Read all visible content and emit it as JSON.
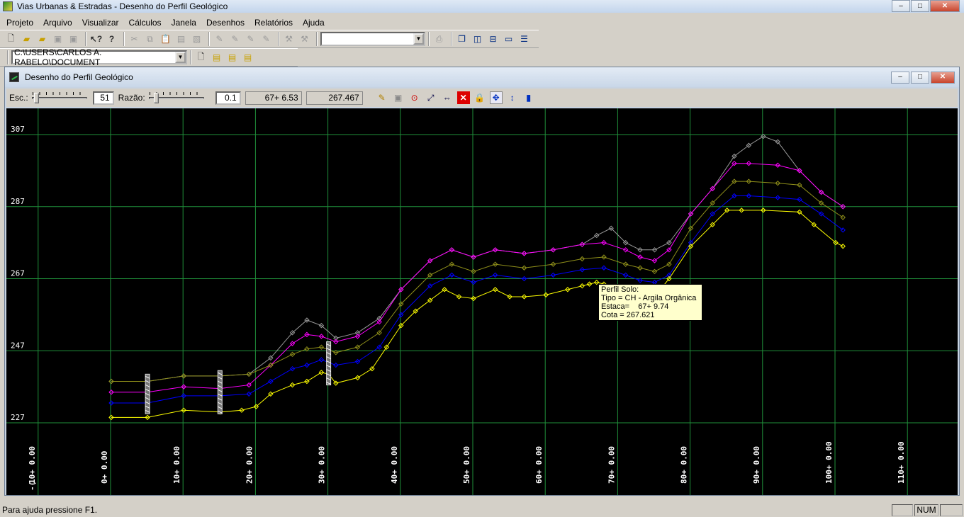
{
  "app": {
    "title": "Vias Urbanas & Estradas -  Desenho do Perfil Geológico",
    "win_min": "‒",
    "win_max": "□",
    "win_close": "✕"
  },
  "menu": [
    "Projeto",
    "Arquivo",
    "Visualizar",
    "Cálculos",
    "Janela",
    "Desenhos",
    "Relatórios",
    "Ajuda"
  ],
  "toolbar2": {
    "path": "C:\\USERS\\CARLOS A. RABELO\\DOCUMENT"
  },
  "child": {
    "title": "Desenho do Perfil Geológico",
    "min": "‒",
    "max": "□",
    "close": "✕"
  },
  "drawtb": {
    "esc_label": "Esc.:",
    "esc_value": "51",
    "razao_label": "Razão:",
    "razao_value": "0.1",
    "estaca_readout": "67+ 6.53",
    "cota_readout": "267.467",
    "esc_slider_level": 0.05,
    "razao_slider_level": 0.1
  },
  "tooltip": {
    "line1": "Perfil Solo:",
    "line2": "Tipo = CH - Argila Orgânica",
    "line3": "Estaca=    67+ 9.74",
    "line4": "Cota = 267.621"
  },
  "status": {
    "message": "Para ajuda pressione F1.",
    "num": "NUM"
  },
  "chart_data": {
    "type": "line",
    "ylim": [
      223,
      309
    ],
    "xlim": [
      -10,
      120
    ],
    "y_ticks": [
      307,
      287,
      267,
      247,
      227
    ],
    "x_ticks": [
      {
        "label": "10+ 0.00",
        "x": -10
      },
      {
        "label": "0+ 0.00",
        "x": 0
      },
      {
        "label": "10+ 0.00",
        "x": 10
      },
      {
        "label": "20+ 0.00",
        "x": 20
      },
      {
        "label": "30+ 0.00",
        "x": 30
      },
      {
        "label": "40+ 0.00",
        "x": 40
      },
      {
        "label": "50+ 0.00",
        "x": 50
      },
      {
        "label": "60+ 0.00",
        "x": 60
      },
      {
        "label": "70+ 0.00",
        "x": 70
      },
      {
        "label": "80+ 0.00",
        "x": 80
      },
      {
        "label": "90+ 0.00",
        "x": 90
      },
      {
        "label": "100+ 0.00",
        "x": 100
      },
      {
        "label": "110+ 0.00",
        "x": 110
      }
    ],
    "x_ticks_prefix": "-(",
    "grid": true,
    "series": [
      {
        "color": "#9a9a9a",
        "x": [
          0,
          5,
          10,
          15,
          19,
          22,
          25,
          27,
          29,
          31,
          34,
          37,
          40,
          44,
          47,
          50,
          53,
          57,
          61,
          65,
          67,
          69,
          71,
          73,
          75,
          77,
          80,
          83,
          86,
          88,
          90,
          92,
          95,
          98,
          101
        ],
        "y": [
          238.5,
          238.5,
          240,
          240,
          240.5,
          245,
          252,
          255.5,
          254,
          250.5,
          252,
          256,
          264,
          272,
          275,
          273,
          275,
          274,
          275,
          276.5,
          279,
          281,
          277,
          275,
          275,
          277,
          285,
          292,
          301,
          304,
          306.5,
          305,
          297,
          291,
          287
        ]
      },
      {
        "color": "#ff00ff",
        "x": [
          0,
          5,
          10,
          15,
          19,
          22,
          25,
          27,
          29,
          31,
          34,
          37,
          40,
          44,
          47,
          50,
          53,
          57,
          61,
          65,
          68,
          71,
          73,
          75,
          77,
          80,
          83,
          86,
          88,
          92,
          95,
          98,
          101
        ],
        "y": [
          235.5,
          235.5,
          237,
          236.5,
          237.5,
          243,
          249,
          251.5,
          251,
          249.5,
          251,
          255,
          264,
          272,
          275,
          273,
          275,
          274,
          275,
          276.5,
          277,
          275,
          273,
          272,
          275,
          285,
          292,
          299,
          299,
          298.5,
          297,
          291,
          287
        ]
      },
      {
        "color": "#8f8f1a",
        "x": [
          0,
          5,
          10,
          15,
          19,
          22,
          25,
          27,
          29,
          31,
          34,
          37,
          40,
          44,
          47,
          50,
          53,
          57,
          61,
          65,
          68,
          71,
          73,
          75,
          77,
          80,
          83,
          86,
          88,
          92,
          95,
          98,
          101
        ],
        "y": [
          238.5,
          238.5,
          240,
          240,
          240.5,
          243,
          246,
          247.5,
          248,
          246.5,
          248,
          252,
          260,
          268,
          271,
          269,
          271,
          270,
          271,
          272.5,
          273,
          271,
          270,
          269,
          271,
          281,
          288,
          294,
          294,
          293.5,
          293,
          288,
          284
        ]
      },
      {
        "color": "#0000ff",
        "x": [
          0,
          5,
          10,
          15,
          19,
          22,
          25,
          27,
          29,
          31,
          34,
          37,
          40,
          44,
          47,
          50,
          53,
          57,
          61,
          65,
          68,
          71,
          73,
          75,
          77,
          80,
          83,
          86,
          88,
          92,
          95,
          98,
          101
        ],
        "y": [
          232.5,
          232.5,
          234.5,
          234.5,
          235,
          238.5,
          242,
          243,
          244.5,
          243,
          244,
          248,
          257,
          265,
          268,
          266,
          268,
          267,
          268,
          269.5,
          270,
          268,
          266.5,
          266,
          268,
          277,
          285,
          290,
          290,
          289.5,
          289,
          285,
          280.5
        ]
      },
      {
        "color": "#ffff00",
        "x": [
          0,
          5,
          10,
          15,
          18,
          20,
          22,
          25,
          27,
          29,
          30,
          31,
          34,
          36,
          38,
          40,
          42,
          44,
          46,
          48,
          50,
          53,
          55,
          57,
          60,
          63,
          65,
          66,
          67,
          68,
          70,
          72,
          74,
          75,
          77,
          80,
          83,
          85,
          87,
          90,
          95,
          97,
          100,
          101
        ],
        "y": [
          228.5,
          228.5,
          230.5,
          230,
          230.5,
          231.5,
          235,
          237.5,
          238.5,
          241,
          240.5,
          238,
          239.5,
          242,
          248,
          254,
          258,
          261,
          264,
          262,
          261.5,
          264,
          262,
          262,
          262.5,
          264,
          265,
          265.5,
          266,
          265.5,
          264,
          262,
          261,
          262,
          267,
          276,
          282,
          286,
          286,
          286,
          285.5,
          282,
          277,
          276
        ]
      }
    ]
  }
}
